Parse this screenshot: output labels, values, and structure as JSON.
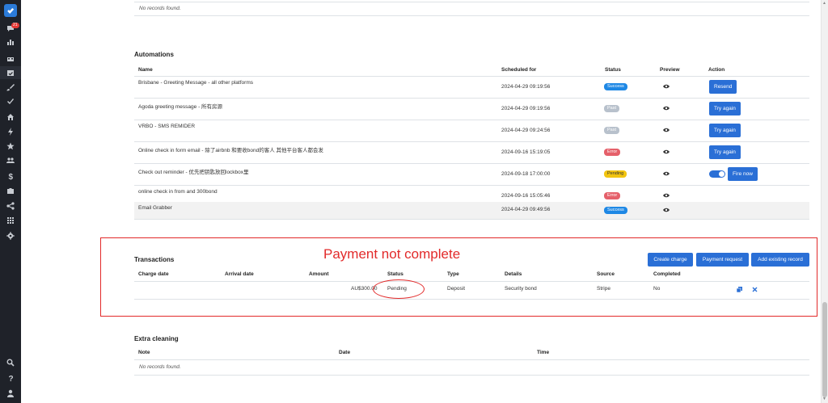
{
  "sidebar": {
    "notification_count": "21",
    "icons": [
      "check-logo-icon",
      "chat-icon",
      "bar-chart-icon",
      "calendar-icon",
      "calendar-check-icon",
      "brush-icon",
      "checkmark-icon",
      "home-icon",
      "bolt-icon",
      "star-icon",
      "users-icon",
      "dollar-icon",
      "briefcase-icon",
      "share-icon",
      "grid-icon",
      "gear-icon",
      "search-icon",
      "help-icon",
      "user-icon"
    ]
  },
  "top_section": {
    "empty_text": "No records found."
  },
  "automations": {
    "title": "Automations",
    "columns": {
      "name": "Name",
      "scheduled": "Scheduled for",
      "status": "Status",
      "preview": "Preview",
      "action": "Action"
    },
    "rows": [
      {
        "name": "Brisbane - Greeting Message - all other platforms",
        "scheduled": "2024-04-29 09:19:56",
        "status": "Success",
        "status_kind": "success",
        "action": "Resend"
      },
      {
        "name": "Agoda greeting message - 所有房源",
        "scheduled": "2024-04-29 09:19:56",
        "status": "Past",
        "status_kind": "past",
        "action": "Try again"
      },
      {
        "name": "VRBO - SMS REMIDER",
        "scheduled": "2024-04-29 09:24:56",
        "status": "Past",
        "status_kind": "past",
        "action": "Try again"
      },
      {
        "name": "Online check in form email - 除了airbnb 和要收bond的客人 其他平台客人都会发",
        "scheduled": "2024-09-16 15:19:05",
        "status": "Error",
        "status_kind": "error",
        "action": "Try again"
      },
      {
        "name": "Check out reminder - 优先把钥匙放回lockbox里",
        "scheduled": "2024-09-18 17:00:00",
        "status": "Pending",
        "status_kind": "pending",
        "action": "Fire now"
      },
      {
        "name": "online check in from and 300bond",
        "scheduled": "2024-09-16 15:05:46",
        "status": "Error",
        "status_kind": "error",
        "action": ""
      },
      {
        "name": "Email Grabber",
        "scheduled": "2024-04-29 09:49:56",
        "status": "Success",
        "status_kind": "success",
        "action": ""
      }
    ]
  },
  "transactions": {
    "title": "Transactions",
    "annotation": "Payment not complete",
    "buttons": {
      "create_charge": "Create charge",
      "payment_request": "Payment request",
      "add_existing": "Add existing record"
    },
    "columns": {
      "charge_date": "Charge date",
      "arrival_date": "Arrival date",
      "amount": "Amount",
      "status": "Status",
      "type": "Type",
      "details": "Details",
      "source": "Source",
      "completed": "Completed"
    },
    "row": {
      "amount": "AU$300.00",
      "status": "Pending",
      "type": "Deposit",
      "details": "Security bond",
      "source": "Stripe",
      "completed": "No"
    }
  },
  "extra_cleaning": {
    "title": "Extra cleaning",
    "columns": {
      "note": "Note",
      "date": "Date",
      "time": "Time"
    },
    "empty_text": "No records found."
  },
  "colors": {
    "sidebar_bg": "#1f2229",
    "primary": "#2a6fd6",
    "success": "#1e88e5",
    "past": "#b8c1cc",
    "error": "#e5606a",
    "pending": "#f2c410",
    "annotation_red": "#e22a2a"
  }
}
